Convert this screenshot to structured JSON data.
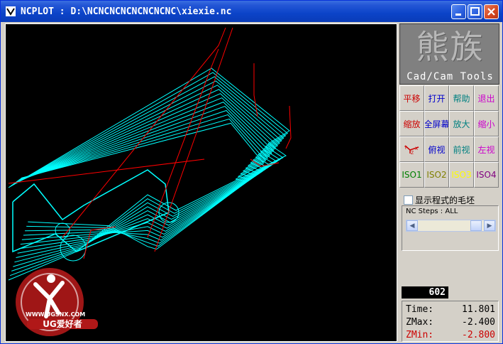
{
  "window": {
    "title": "NCPLOT : D:\\NCNCNCNCNCNCNCNC\\xiexie.nc",
    "title_color": "#0b43c8"
  },
  "logo": {
    "chinese": "熊族",
    "english": "Cad/Cam Tools"
  },
  "toolbar": {
    "buttons": [
      {
        "label": "平移",
        "color": "#cc0000"
      },
      {
        "label": "打开",
        "color": "#0000cc"
      },
      {
        "label": "帮助",
        "color": "#008080"
      },
      {
        "label": "退出",
        "color": "#cc00cc"
      },
      {
        "label": "缩放",
        "color": "#cc0000"
      },
      {
        "label": "全屏幕",
        "color": "#0000cc"
      },
      {
        "label": "放大",
        "color": "#008080"
      },
      {
        "label": "缩小",
        "color": "#cc00cc"
      },
      {
        "label": "",
        "color": "#cc0000",
        "icon": "xyz-axis-icon"
      },
      {
        "label": "俯视",
        "color": "#0000cc"
      },
      {
        "label": "前视",
        "color": "#008080"
      },
      {
        "label": "左视",
        "color": "#cc00cc"
      },
      {
        "label": "ISO1",
        "color": "#008000"
      },
      {
        "label": "ISO2",
        "color": "#808000"
      },
      {
        "label": "ISO3",
        "color": "#ffff00"
      },
      {
        "label": "ISO4",
        "color": "#800080"
      }
    ]
  },
  "options": {
    "show_stock_label": "显示程式的毛坯",
    "show_stock_checked": false
  },
  "nc_steps": {
    "label": "NC Steps : ALL"
  },
  "counter": {
    "value": "602"
  },
  "stats": [
    {
      "key": "Time:",
      "value": "11.801",
      "color": "#000000"
    },
    {
      "key": "ZMax:",
      "value": "-2.400",
      "color": "#000000"
    },
    {
      "key": "ZMin:",
      "value": "-2.800",
      "color": "#cc0000"
    }
  ],
  "watermark": {
    "text": "UG爱好者",
    "url": "WWW.UGSNX.COM"
  },
  "colors": {
    "toolpath": "#00ffff",
    "rapid": "#ff0000",
    "canvas_bg": "#000000"
  }
}
